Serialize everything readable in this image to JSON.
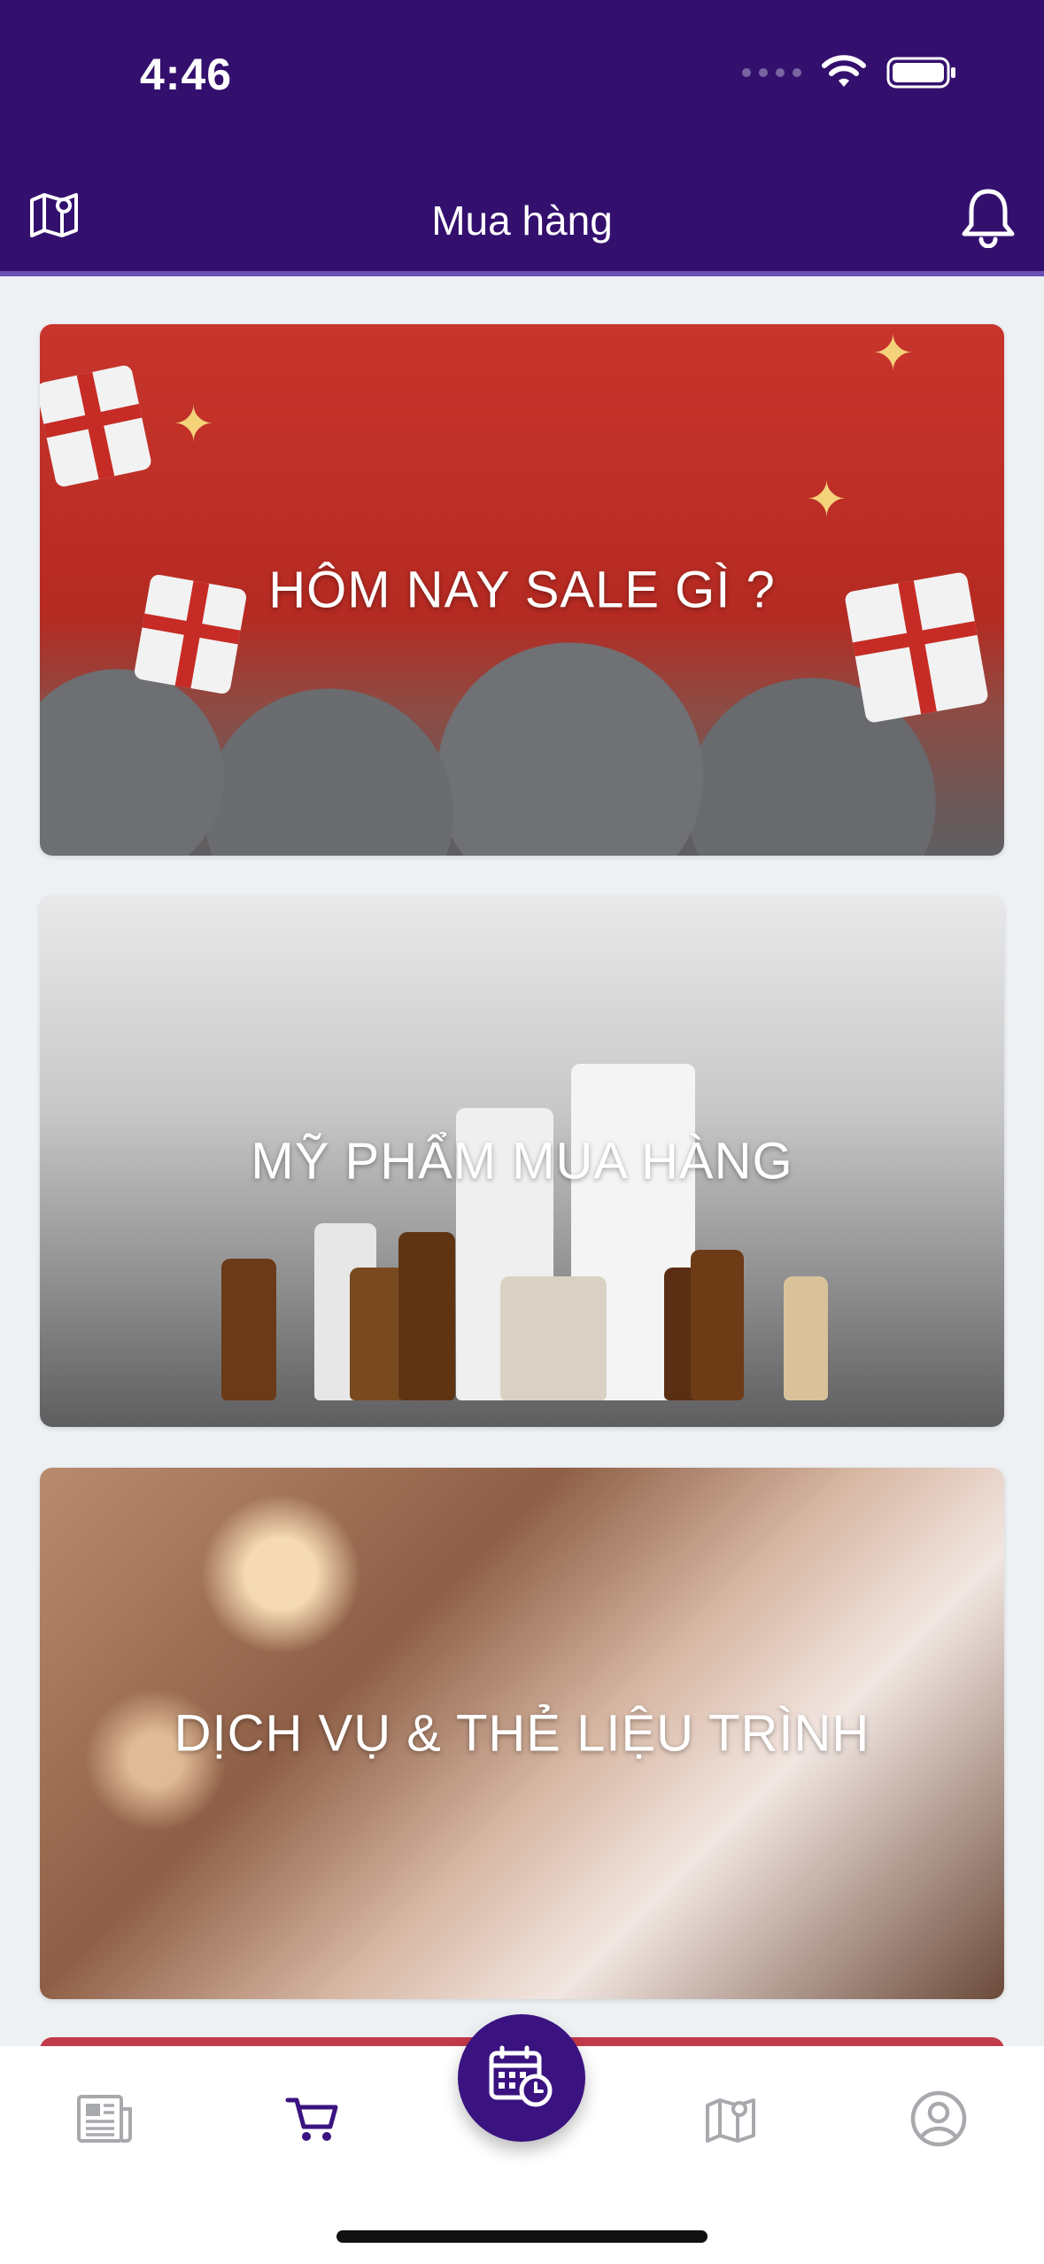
{
  "status_bar": {
    "time": "4:46"
  },
  "header": {
    "title": "Mua hàng"
  },
  "cards": [
    {
      "title": "HÔM NAY SALE GÌ ?"
    },
    {
      "title": "MỸ PHẨM MUA HÀNG"
    },
    {
      "title": "DỊCH VỤ & THẺ LIỆU TRÌNH"
    }
  ],
  "tabbar": {
    "active_tab": "cart",
    "tabs": [
      {
        "icon": "newspaper-icon"
      },
      {
        "icon": "cart-icon"
      },
      {
        "icon": "calendar-clock-icon"
      },
      {
        "icon": "map-icon"
      },
      {
        "icon": "profile-icon"
      }
    ]
  },
  "colors": {
    "header_bg": "#34106e",
    "accent": "#3a1380",
    "inactive_icon": "#a7a9ad"
  }
}
